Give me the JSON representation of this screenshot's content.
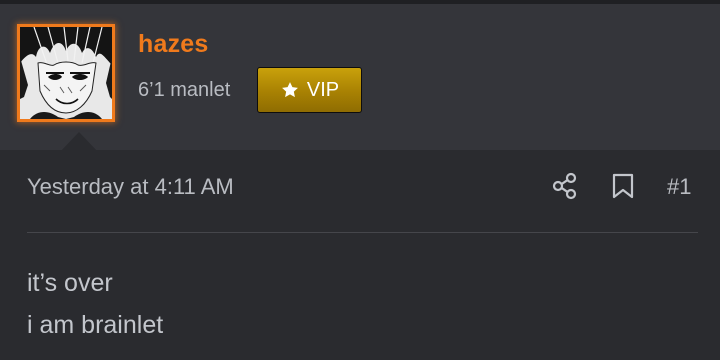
{
  "user": {
    "name": "hazes",
    "title": "6’1 manlet",
    "badge_label": "VIP",
    "accent_color": "#f07a1c",
    "badge_color": "#b08a06"
  },
  "post": {
    "timestamp": "Yesterday at 4:11 AM",
    "number": "#1",
    "body": [
      "it’s over",
      "i am brainlet"
    ]
  },
  "icons": {
    "share": "share-icon",
    "bookmark": "bookmark-icon",
    "badge": "star-icon"
  }
}
